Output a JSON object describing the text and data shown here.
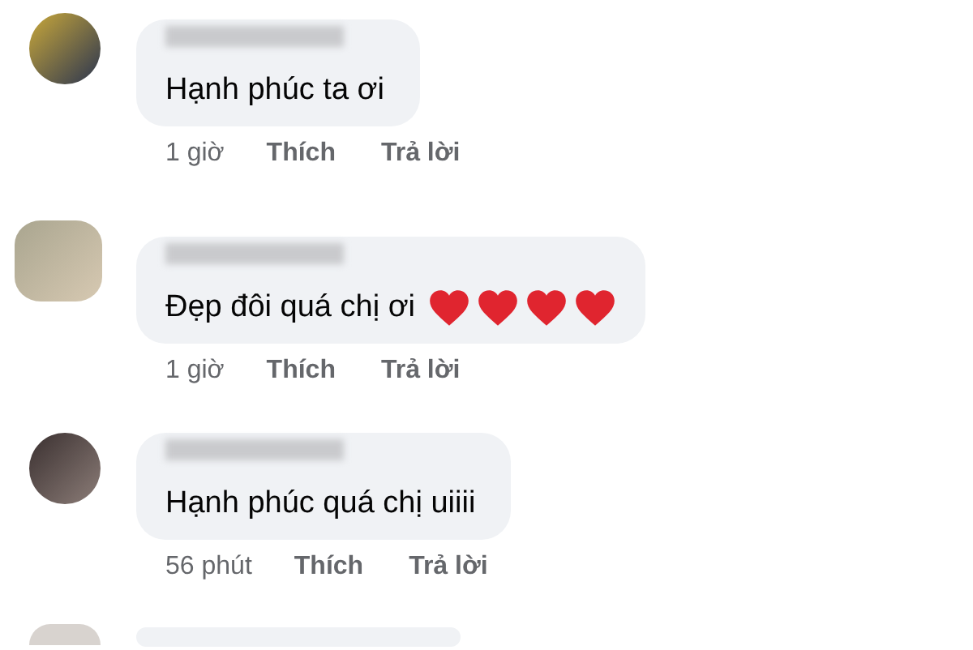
{
  "comments": [
    {
      "text": "Hạnh phúc ta ơi",
      "actions": {
        "time": "1 giờ",
        "like": "Thích",
        "reply": "Trả lời"
      }
    },
    {
      "text": "Đẹp đôi quá chị ơi",
      "icons": [
        {
          "kind": "heart"
        },
        {
          "kind": "heart"
        },
        {
          "kind": "heart"
        },
        {
          "kind": "heart"
        }
      ],
      "actions": {
        "time": "1 giờ",
        "like": "Thích",
        "reply": "Trả lời"
      }
    },
    {
      "text": "Hạnh phúc quá chị uiiii",
      "actions": {
        "time": "56 phút",
        "like": "Thích",
        "reply": "Trả lời"
      }
    }
  ]
}
